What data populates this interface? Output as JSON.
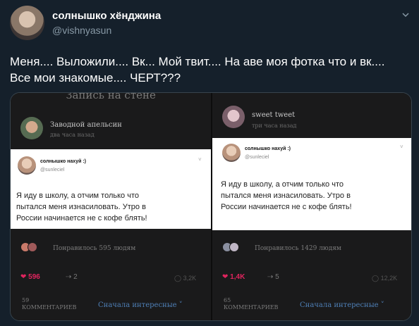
{
  "author": {
    "name": "солнышко хёнджина",
    "handle": "@vishnyasun"
  },
  "tweet": {
    "text_line1": "Меня.... Выложили.... Вк... Мой твит.... На аве моя фотка что и вк....",
    "text_line2": "Все мои знакомые.... ЧЕРТ???"
  },
  "panels": [
    {
      "topbar": "Запись на стене",
      "poster_name": "Заводной апельсин",
      "poster_time": "два часа назад",
      "card": {
        "name": "солнышко нахуй :)",
        "handle": "@sunleciel",
        "lines": [
          "Я иду в школу, а отчим только что",
          "пытался меня изнасиловать. Утро в",
          "России начинается не с кофе блять!"
        ]
      },
      "likes_text": "Понравилось 595 людям",
      "like_count": "596",
      "share_count": "2",
      "views": "3,2K",
      "comments_count": "59",
      "comments_label": "КОММЕНТАРИЕВ",
      "sort_label": "Сначала интересные ˅"
    },
    {
      "poster_name": "sweet tweet",
      "poster_time": "три часа назад",
      "card": {
        "name": "солнышко нахуй :)",
        "handle": "@sunleciel",
        "lines": [
          "Я иду в школу, а отчим только что",
          "пытался меня изнасиловать. Утро в",
          "России начинается не с кофе блять!"
        ]
      },
      "likes_text": "Понравилось 1429 людям",
      "like_count": "1,4K",
      "share_count": "5",
      "views": "12,2K",
      "comments_count": "65",
      "comments_label": "КОММЕНТАРИЕВ",
      "sort_label": "Сначала интересные ˅"
    }
  ],
  "icons": {
    "more": "chevron-down-icon",
    "heart": "heart-icon",
    "share": "share-icon",
    "views": "eye-icon"
  },
  "colors": {
    "background": "#15202b",
    "like": "#e0245e",
    "link": "#4e7fb6"
  }
}
